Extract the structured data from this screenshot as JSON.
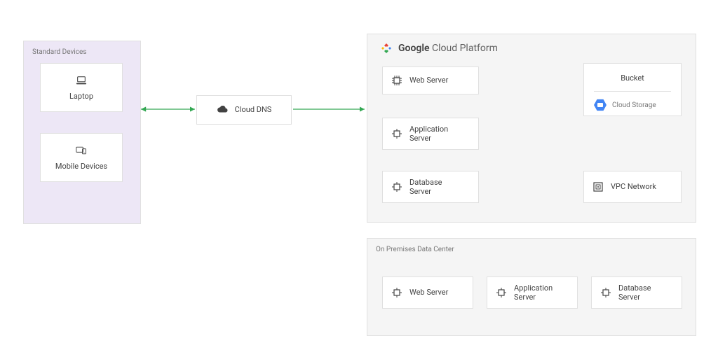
{
  "panels": {
    "devices": {
      "title": "Standard Devices"
    },
    "gcp": {
      "brand_bold": "Google",
      "brand_rest": " Cloud Platform"
    },
    "onprem": {
      "title": "On Premises Data Center"
    }
  },
  "nodes": {
    "laptop": {
      "label": "Laptop"
    },
    "mobile": {
      "label": "Mobile Devices"
    },
    "cloud_dns": {
      "label": "Cloud DNS"
    },
    "web_server": {
      "label": "Web Server"
    },
    "app_server": {
      "label": "Application\nServer"
    },
    "db_server": {
      "label": "Database\nServer"
    },
    "bucket": {
      "label": "Bucket",
      "service": "Cloud Storage"
    },
    "vpc": {
      "label": "VPC Network"
    },
    "op_web": {
      "label": "Web Server"
    },
    "op_app": {
      "label": "Application\nServer"
    },
    "op_db": {
      "label": "Database\nServer"
    }
  },
  "colors": {
    "arrow": "#34a853",
    "panel_purple": "#ede7f6",
    "panel_gray": "#f5f5f5"
  },
  "edges": [
    {
      "from": "devices-panel",
      "to": "cloud_dns",
      "bidirectional": true
    },
    {
      "from": "cloud_dns",
      "to": "gcp-panel",
      "bidirectional": false
    },
    {
      "from": "bucket",
      "to": "db_server",
      "bidirectional": false,
      "routing": "orthogonal"
    }
  ],
  "chart_data": {
    "type": "diagram",
    "title": "Cloud architecture diagram",
    "groups": [
      {
        "id": "devices",
        "label": "Standard Devices",
        "children": [
          "laptop",
          "mobile"
        ]
      },
      {
        "id": "gcp",
        "label": "Google Cloud Platform",
        "children": [
          "web_server",
          "app_server",
          "db_server",
          "bucket",
          "vpc"
        ]
      },
      {
        "id": "onprem",
        "label": "On Premises Data Center",
        "children": [
          "op_web",
          "op_app",
          "op_db"
        ]
      }
    ],
    "nodes": [
      {
        "id": "laptop",
        "label": "Laptop",
        "icon": "laptop"
      },
      {
        "id": "mobile",
        "label": "Mobile Devices",
        "icon": "devices"
      },
      {
        "id": "cloud_dns",
        "label": "Cloud DNS",
        "icon": "cloud"
      },
      {
        "id": "web_server",
        "label": "Web Server",
        "icon": "compute"
      },
      {
        "id": "app_server",
        "label": "Application Server",
        "icon": "compute"
      },
      {
        "id": "db_server",
        "label": "Database Server",
        "icon": "compute"
      },
      {
        "id": "bucket",
        "label": "Bucket",
        "service": "Cloud Storage",
        "icon": "storage-hex"
      },
      {
        "id": "vpc",
        "label": "VPC Network",
        "icon": "vpc"
      },
      {
        "id": "op_web",
        "label": "Web Server",
        "icon": "compute"
      },
      {
        "id": "op_app",
        "label": "Application Server",
        "icon": "compute"
      },
      {
        "id": "op_db",
        "label": "Database Server",
        "icon": "compute"
      }
    ],
    "edges": [
      {
        "from": "devices",
        "to": "cloud_dns",
        "bidirectional": true
      },
      {
        "from": "cloud_dns",
        "to": "gcp",
        "bidirectional": false
      },
      {
        "from": "bucket",
        "to": "db_server",
        "bidirectional": false
      }
    ]
  }
}
